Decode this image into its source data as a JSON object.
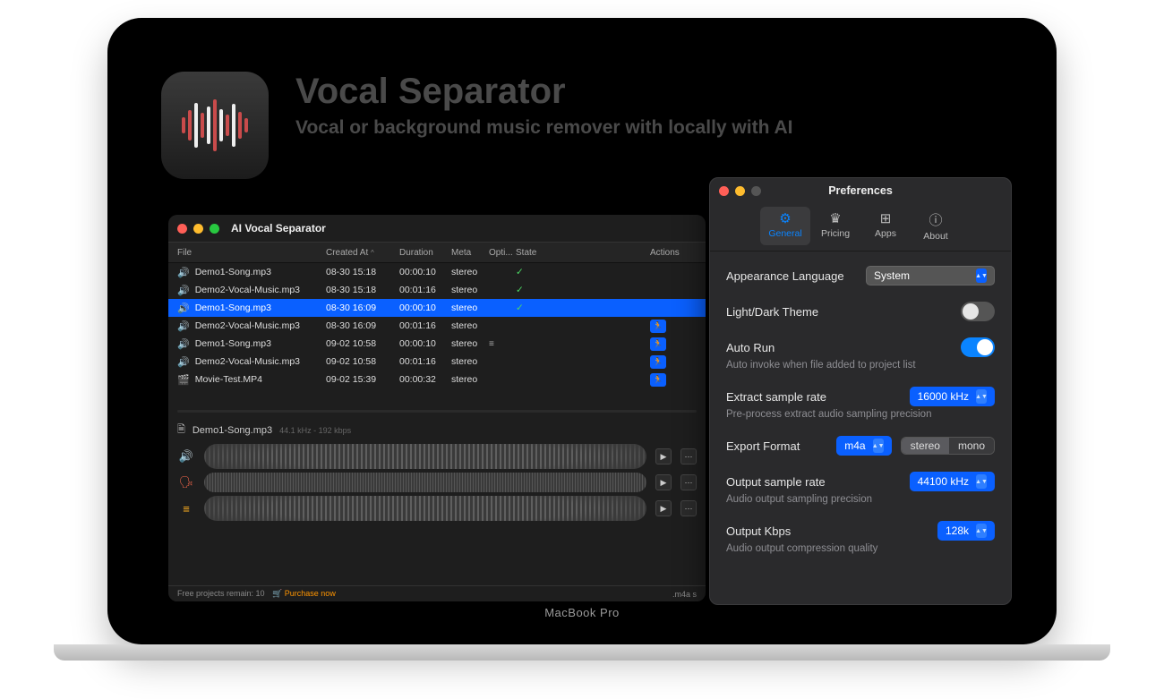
{
  "hero": {
    "title": "Vocal Separator",
    "subtitle": "Vocal or background music remover with locally with AI"
  },
  "laptop_brand": "MacBook Pro",
  "main": {
    "title": "AI Vocal Separator",
    "columns": {
      "file": "File",
      "created": "Created At",
      "duration": "Duration",
      "meta": "Meta",
      "options": "Opti...",
      "state": "State",
      "actions": "Actions"
    },
    "rows": [
      {
        "icon": "teal",
        "name": "Demo1-Song.mp3",
        "created": "08-30 15:18",
        "dur": "00:00:10",
        "meta": "stereo",
        "opt": "",
        "state": "done",
        "action": ""
      },
      {
        "icon": "green",
        "name": "Demo2-Vocal-Music.mp3",
        "created": "08-30 15:18",
        "dur": "00:01:16",
        "meta": "stereo",
        "opt": "",
        "state": "done",
        "action": ""
      },
      {
        "icon": "white",
        "name": "Demo1-Song.mp3",
        "created": "08-30 16:09",
        "dur": "00:00:10",
        "meta": "stereo",
        "opt": "",
        "state": "done",
        "action": "",
        "selected": true
      },
      {
        "icon": "green",
        "name": "Demo2-Vocal-Music.mp3",
        "created": "08-30 16:09",
        "dur": "00:01:16",
        "meta": "stereo",
        "opt": "",
        "state": "",
        "action": "run"
      },
      {
        "icon": "teal",
        "name": "Demo1-Song.mp3",
        "created": "09-02 10:58",
        "dur": "00:00:10",
        "meta": "stereo",
        "opt": "opts",
        "state": "",
        "action": "run"
      },
      {
        "icon": "green",
        "name": "Demo2-Vocal-Music.mp3",
        "created": "09-02 10:58",
        "dur": "00:01:16",
        "meta": "stereo",
        "opt": "",
        "state": "",
        "action": "run"
      },
      {
        "icon": "blue",
        "name": "Movie-Test.MP4",
        "created": "09-02 15:39",
        "dur": "00:00:32",
        "meta": "stereo",
        "opt": "",
        "state": "",
        "action": "run"
      }
    ],
    "now_playing": {
      "file": "Demo1-Song.mp3",
      "meta": "44.1 kHz - 192 kbps"
    },
    "tracks": [
      {
        "icon": "mix",
        "color": "#2fb7a6"
      },
      {
        "icon": "vocal",
        "color": "#ff6a4d"
      },
      {
        "icon": "music",
        "color": "#ffb020"
      }
    ],
    "footer": {
      "remain": "Free projects remain: 10",
      "buy": "Purchase now",
      "fmt": ".m4a  s"
    }
  },
  "prefs": {
    "title": "Preferences",
    "tabs": [
      {
        "id": "general",
        "label": "General",
        "icon": "⚙"
      },
      {
        "id": "pricing",
        "label": "Pricing",
        "icon": "♛"
      },
      {
        "id": "apps",
        "label": "Apps",
        "icon": "⊞"
      },
      {
        "id": "about",
        "label": "About",
        "icon": "ⓘ"
      }
    ],
    "active_tab": "general",
    "appearance_lang": {
      "label": "Appearance Language",
      "value": "System"
    },
    "theme": {
      "label": "Light/Dark Theme",
      "on": false
    },
    "autorun": {
      "label": "Auto Run",
      "sub": "Auto invoke when file added to project list",
      "on": true
    },
    "extract_rate": {
      "label": "Extract sample rate",
      "sub": "Pre-process extract audio sampling precision",
      "value": "16000 kHz"
    },
    "export_format": {
      "label": "Export Format",
      "value": "m4a",
      "channels": [
        "stereo",
        "mono"
      ],
      "channel_sel": "stereo"
    },
    "output_rate": {
      "label": "Output sample rate",
      "sub": "Audio output sampling precision",
      "value": "44100 kHz"
    },
    "output_kbps": {
      "label": "Output Kbps",
      "sub": "Audio output compression quality",
      "value": "128k"
    }
  }
}
